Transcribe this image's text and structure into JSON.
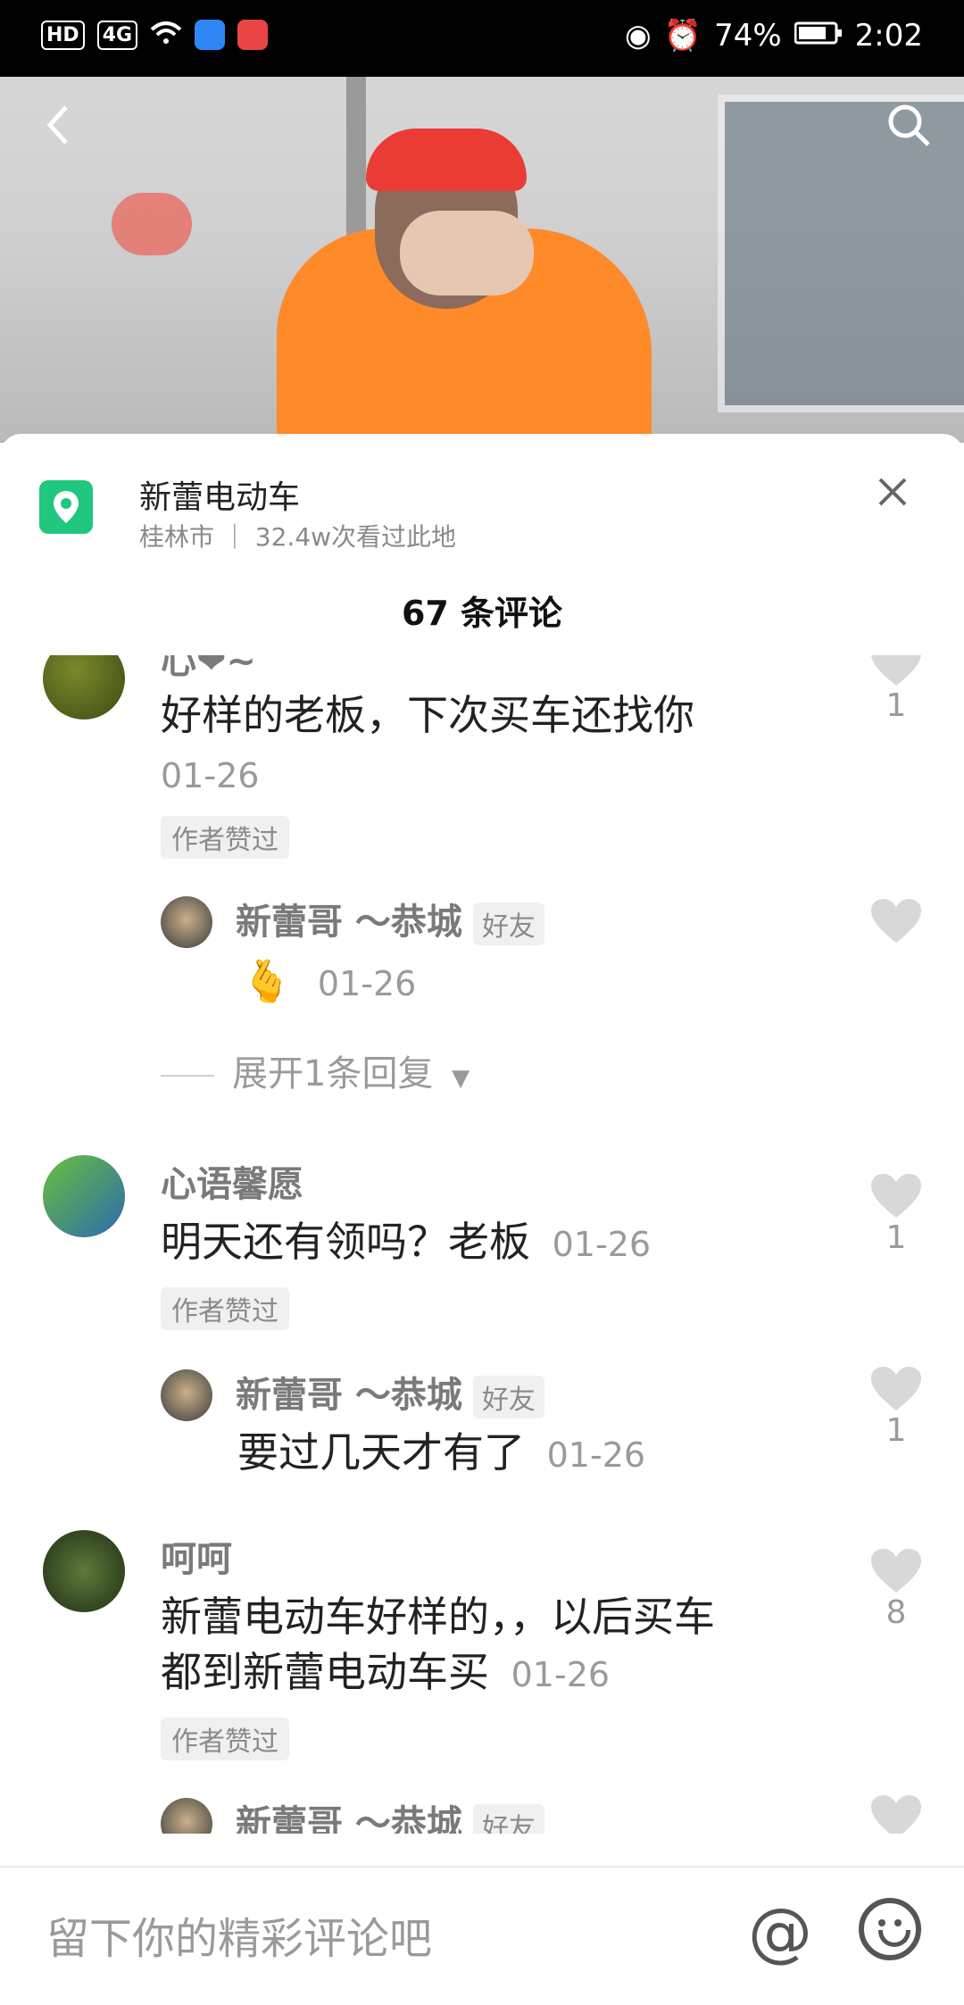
{
  "status_bar": {
    "left_badges": [
      "HD",
      "4G"
    ],
    "battery": "74%",
    "time": "2:02"
  },
  "location": {
    "title": "新蕾电动车",
    "subtitle": "桂林市 ｜ 32.4w次看过此地"
  },
  "comments_header": "67 条评论",
  "comments": [
    {
      "user": "心❤~",
      "text": "好样的老板，下次买车还找你",
      "date": "01-26",
      "tag": "作者赞过",
      "likes": "1",
      "reply": {
        "user": "新蕾哥 ～恭城",
        "friend": "好友",
        "text": "🫰",
        "date": "01-26"
      },
      "expand": "展开1条回复"
    },
    {
      "user": "心语馨愿",
      "text": "明天还有领吗？老板",
      "date": "01-26",
      "tag": "作者赞过",
      "likes": "1",
      "reply": {
        "user": "新蕾哥 ～恭城",
        "friend": "好友",
        "text": "要过几天才有了",
        "date": "01-26",
        "likes": "1"
      }
    },
    {
      "user": "呵呵",
      "text_line1": "新蕾电动车好样的，，以后买车",
      "text_line2": "都到新蕾电动车买",
      "date": "01-26",
      "tag": "作者赞过",
      "likes": "8",
      "reply": {
        "user": "新蕾哥 ～恭城",
        "friend": "好友"
      }
    }
  ],
  "input_placeholder": "留下你的精彩评论吧",
  "icons": {
    "back": "chevron-left-icon",
    "search": "search-icon",
    "close": "close-icon",
    "location": "map-pin-icon",
    "heart": "heart-icon",
    "at": "at-icon",
    "emoji": "emoji-icon"
  },
  "colors": {
    "accent_green": "#1fc77f",
    "heart_gray": "#d8d8d8",
    "text_gray": "#9a9a9a"
  }
}
